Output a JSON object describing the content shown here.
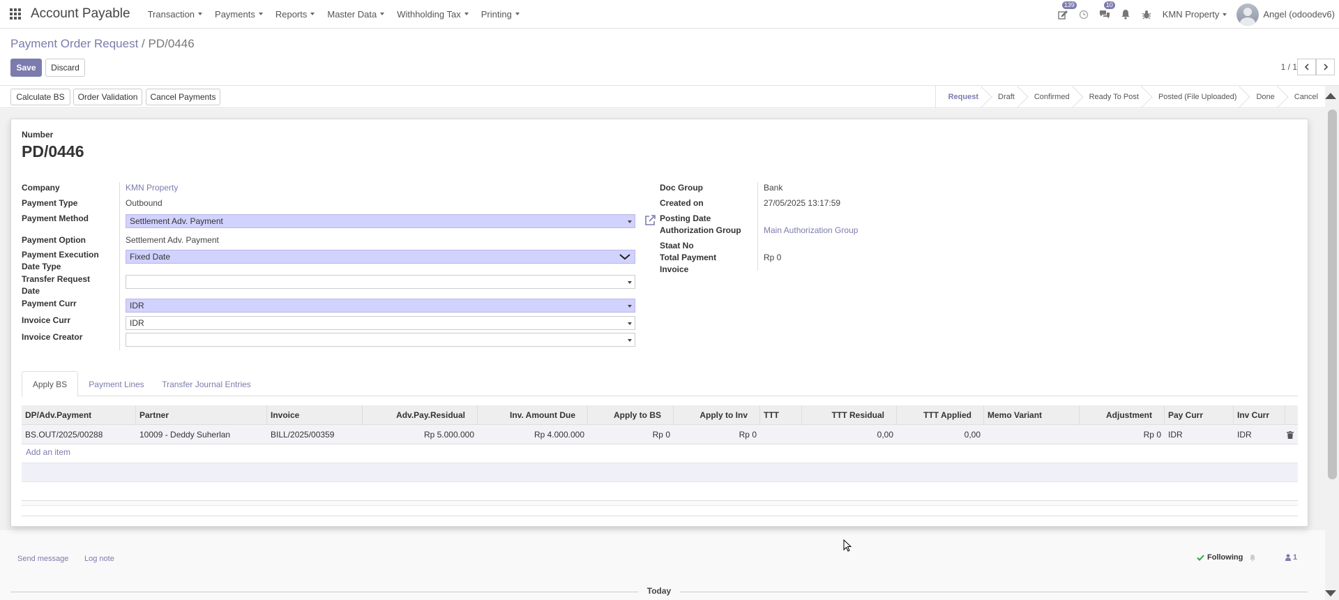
{
  "navbar": {
    "app_title": "Account Payable",
    "menus": [
      "Transaction",
      "Payments",
      "Reports",
      "Master Data",
      "Withholding Tax",
      "Printing"
    ],
    "activity_badge": "139",
    "messages_badge": "10",
    "company": "KMN Property",
    "user": "Angel (odoodev6)"
  },
  "breadcrumb": {
    "parent": "Payment Order Request",
    "separator": "/",
    "current": "PD/0446"
  },
  "buttons": {
    "save": "Save",
    "discard": "Discard"
  },
  "pager": {
    "value": "1 / 1"
  },
  "statusbar": {
    "actions": [
      "Calculate BS",
      "Order Validation",
      "Cancel Payments"
    ],
    "stages": [
      "Request",
      "Draft",
      "Confirmed",
      "Ready To Post",
      "Posted (File Uploaded)",
      "Done",
      "Cancel"
    ],
    "active_stage": "Request"
  },
  "form": {
    "number_label": "Number",
    "number": "PD/0446",
    "left": {
      "company_label": "Company",
      "company": "KMN Property",
      "payment_type_label": "Payment Type",
      "payment_type": "Outbound",
      "payment_method_label": "Payment Method",
      "payment_method": "Settlement Adv. Payment",
      "payment_option_label": "Payment Option",
      "payment_option": "Settlement Adv. Payment",
      "exec_date_type_label_1": "Payment Execution",
      "exec_date_type_label_2": "Date Type",
      "exec_date_type": "Fixed Date",
      "transfer_req_label_1": "Transfer Request",
      "transfer_req_label_2": "Date",
      "transfer_req": "",
      "payment_curr_label": "Payment Curr",
      "payment_curr": "IDR",
      "invoice_curr_label": "Invoice Curr",
      "invoice_curr": "IDR",
      "invoice_creator_label": "Invoice Creator",
      "invoice_creator": ""
    },
    "right": {
      "doc_group_label": "Doc Group",
      "doc_group": "Bank",
      "created_on_label": "Created on",
      "created_on": "27/05/2025 13:17:59",
      "posting_date_label": "Posting Date",
      "auth_group_label": "Authorization Group",
      "auth_group": "Main Authorization Group",
      "staat_no_label": "Staat No",
      "total_payment_label_1": "Total Payment",
      "total_payment_label_2": "Invoice",
      "total_payment": "Rp 0"
    }
  },
  "tabs": [
    "Apply BS",
    "Payment Lines",
    "Transfer Journal Entries"
  ],
  "table": {
    "headers": [
      "DP/Adv.Payment",
      "Partner",
      "Invoice",
      "Adv.Pay.Residual",
      "Inv. Amount Due",
      "Apply to BS",
      "Apply to Inv",
      "TTT",
      "TTT Residual",
      "TTT Applied",
      "Memo Variant",
      "Adjustment",
      "Pay Curr",
      "Inv Curr"
    ],
    "rows": [
      [
        "BS.OUT/2025/00288",
        "10009 - Deddy Suherlan",
        "BILL/2025/00359",
        "Rp 5.000.000",
        "Rp 4.000.000",
        "Rp 0",
        "Rp 0",
        "",
        "0,00",
        "0,00",
        "",
        "Rp 0",
        "IDR",
        "IDR"
      ]
    ],
    "add_item": "Add an item"
  },
  "chatter": {
    "send_message": "Send message",
    "log_note": "Log note",
    "following": "Following",
    "followers": "1",
    "date_separator": "Today"
  },
  "colors": {
    "accent": "#7c7bad",
    "required_field": "#d2d2ff"
  }
}
